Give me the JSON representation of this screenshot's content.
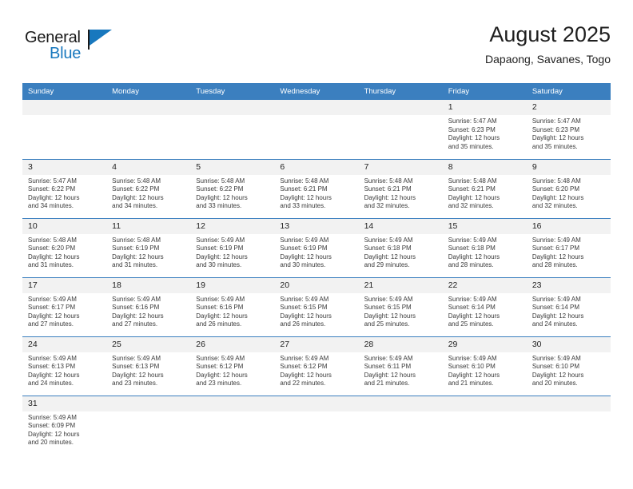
{
  "logo": {
    "part1": "General",
    "part2": "Blue",
    "accent_color": "#1878be"
  },
  "header": {
    "title": "August 2025",
    "subtitle": "Dapaong, Savanes, Togo"
  },
  "theme": {
    "header_blue": "#3b7fbf",
    "daynum_band": "#f2f2f2",
    "text": "#3a3a3a"
  },
  "weekdays": [
    "Sunday",
    "Monday",
    "Tuesday",
    "Wednesday",
    "Thursday",
    "Friday",
    "Saturday"
  ],
  "labels": {
    "sunrise_prefix": "Sunrise:",
    "sunset_prefix": "Sunset:",
    "daylight_prefix": "Daylight:"
  },
  "weeks": [
    [
      {
        "day": "",
        "empty": true
      },
      {
        "day": "",
        "empty": true
      },
      {
        "day": "",
        "empty": true
      },
      {
        "day": "",
        "empty": true
      },
      {
        "day": "",
        "empty": true
      },
      {
        "day": "1",
        "sunrise": "Sunrise: 5:47 AM",
        "sunset": "Sunset: 6:23 PM",
        "daylight1": "Daylight: 12 hours",
        "daylight2": "and 35 minutes."
      },
      {
        "day": "2",
        "sunrise": "Sunrise: 5:47 AM",
        "sunset": "Sunset: 6:23 PM",
        "daylight1": "Daylight: 12 hours",
        "daylight2": "and 35 minutes."
      }
    ],
    [
      {
        "day": "3",
        "sunrise": "Sunrise: 5:47 AM",
        "sunset": "Sunset: 6:22 PM",
        "daylight1": "Daylight: 12 hours",
        "daylight2": "and 34 minutes."
      },
      {
        "day": "4",
        "sunrise": "Sunrise: 5:48 AM",
        "sunset": "Sunset: 6:22 PM",
        "daylight1": "Daylight: 12 hours",
        "daylight2": "and 34 minutes."
      },
      {
        "day": "5",
        "sunrise": "Sunrise: 5:48 AM",
        "sunset": "Sunset: 6:22 PM",
        "daylight1": "Daylight: 12 hours",
        "daylight2": "and 33 minutes."
      },
      {
        "day": "6",
        "sunrise": "Sunrise: 5:48 AM",
        "sunset": "Sunset: 6:21 PM",
        "daylight1": "Daylight: 12 hours",
        "daylight2": "and 33 minutes."
      },
      {
        "day": "7",
        "sunrise": "Sunrise: 5:48 AM",
        "sunset": "Sunset: 6:21 PM",
        "daylight1": "Daylight: 12 hours",
        "daylight2": "and 32 minutes."
      },
      {
        "day": "8",
        "sunrise": "Sunrise: 5:48 AM",
        "sunset": "Sunset: 6:21 PM",
        "daylight1": "Daylight: 12 hours",
        "daylight2": "and 32 minutes."
      },
      {
        "day": "9",
        "sunrise": "Sunrise: 5:48 AM",
        "sunset": "Sunset: 6:20 PM",
        "daylight1": "Daylight: 12 hours",
        "daylight2": "and 32 minutes."
      }
    ],
    [
      {
        "day": "10",
        "sunrise": "Sunrise: 5:48 AM",
        "sunset": "Sunset: 6:20 PM",
        "daylight1": "Daylight: 12 hours",
        "daylight2": "and 31 minutes."
      },
      {
        "day": "11",
        "sunrise": "Sunrise: 5:48 AM",
        "sunset": "Sunset: 6:19 PM",
        "daylight1": "Daylight: 12 hours",
        "daylight2": "and 31 minutes."
      },
      {
        "day": "12",
        "sunrise": "Sunrise: 5:49 AM",
        "sunset": "Sunset: 6:19 PM",
        "daylight1": "Daylight: 12 hours",
        "daylight2": "and 30 minutes."
      },
      {
        "day": "13",
        "sunrise": "Sunrise: 5:49 AM",
        "sunset": "Sunset: 6:19 PM",
        "daylight1": "Daylight: 12 hours",
        "daylight2": "and 30 minutes."
      },
      {
        "day": "14",
        "sunrise": "Sunrise: 5:49 AM",
        "sunset": "Sunset: 6:18 PM",
        "daylight1": "Daylight: 12 hours",
        "daylight2": "and 29 minutes."
      },
      {
        "day": "15",
        "sunrise": "Sunrise: 5:49 AM",
        "sunset": "Sunset: 6:18 PM",
        "daylight1": "Daylight: 12 hours",
        "daylight2": "and 28 minutes."
      },
      {
        "day": "16",
        "sunrise": "Sunrise: 5:49 AM",
        "sunset": "Sunset: 6:17 PM",
        "daylight1": "Daylight: 12 hours",
        "daylight2": "and 28 minutes."
      }
    ],
    [
      {
        "day": "17",
        "sunrise": "Sunrise: 5:49 AM",
        "sunset": "Sunset: 6:17 PM",
        "daylight1": "Daylight: 12 hours",
        "daylight2": "and 27 minutes."
      },
      {
        "day": "18",
        "sunrise": "Sunrise: 5:49 AM",
        "sunset": "Sunset: 6:16 PM",
        "daylight1": "Daylight: 12 hours",
        "daylight2": "and 27 minutes."
      },
      {
        "day": "19",
        "sunrise": "Sunrise: 5:49 AM",
        "sunset": "Sunset: 6:16 PM",
        "daylight1": "Daylight: 12 hours",
        "daylight2": "and 26 minutes."
      },
      {
        "day": "20",
        "sunrise": "Sunrise: 5:49 AM",
        "sunset": "Sunset: 6:15 PM",
        "daylight1": "Daylight: 12 hours",
        "daylight2": "and 26 minutes."
      },
      {
        "day": "21",
        "sunrise": "Sunrise: 5:49 AM",
        "sunset": "Sunset: 6:15 PM",
        "daylight1": "Daylight: 12 hours",
        "daylight2": "and 25 minutes."
      },
      {
        "day": "22",
        "sunrise": "Sunrise: 5:49 AM",
        "sunset": "Sunset: 6:14 PM",
        "daylight1": "Daylight: 12 hours",
        "daylight2": "and 25 minutes."
      },
      {
        "day": "23",
        "sunrise": "Sunrise: 5:49 AM",
        "sunset": "Sunset: 6:14 PM",
        "daylight1": "Daylight: 12 hours",
        "daylight2": "and 24 minutes."
      }
    ],
    [
      {
        "day": "24",
        "sunrise": "Sunrise: 5:49 AM",
        "sunset": "Sunset: 6:13 PM",
        "daylight1": "Daylight: 12 hours",
        "daylight2": "and 24 minutes."
      },
      {
        "day": "25",
        "sunrise": "Sunrise: 5:49 AM",
        "sunset": "Sunset: 6:13 PM",
        "daylight1": "Daylight: 12 hours",
        "daylight2": "and 23 minutes."
      },
      {
        "day": "26",
        "sunrise": "Sunrise: 5:49 AM",
        "sunset": "Sunset: 6:12 PM",
        "daylight1": "Daylight: 12 hours",
        "daylight2": "and 23 minutes."
      },
      {
        "day": "27",
        "sunrise": "Sunrise: 5:49 AM",
        "sunset": "Sunset: 6:12 PM",
        "daylight1": "Daylight: 12 hours",
        "daylight2": "and 22 minutes."
      },
      {
        "day": "28",
        "sunrise": "Sunrise: 5:49 AM",
        "sunset": "Sunset: 6:11 PM",
        "daylight1": "Daylight: 12 hours",
        "daylight2": "and 21 minutes."
      },
      {
        "day": "29",
        "sunrise": "Sunrise: 5:49 AM",
        "sunset": "Sunset: 6:10 PM",
        "daylight1": "Daylight: 12 hours",
        "daylight2": "and 21 minutes."
      },
      {
        "day": "30",
        "sunrise": "Sunrise: 5:49 AM",
        "sunset": "Sunset: 6:10 PM",
        "daylight1": "Daylight: 12 hours",
        "daylight2": "and 20 minutes."
      }
    ],
    [
      {
        "day": "31",
        "sunrise": "Sunrise: 5:49 AM",
        "sunset": "Sunset: 6:09 PM",
        "daylight1": "Daylight: 12 hours",
        "daylight2": "and 20 minutes."
      },
      {
        "day": "",
        "empty": true
      },
      {
        "day": "",
        "empty": true
      },
      {
        "day": "",
        "empty": true
      },
      {
        "day": "",
        "empty": true
      },
      {
        "day": "",
        "empty": true
      },
      {
        "day": "",
        "empty": true
      }
    ]
  ]
}
